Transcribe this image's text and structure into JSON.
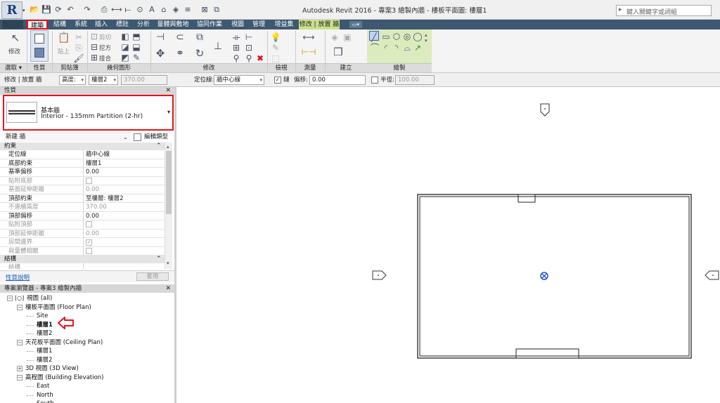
{
  "app": {
    "title": "Autodesk Revit 2016 -     專案3 繪製內牆 - 樓板平面圖: 樓層1",
    "search_placeholder": "鍵入關鍵字或詞組",
    "logo_letter": "R"
  },
  "qat_icons": [
    "open-icon",
    "save-icon",
    "sync-icon",
    "undo-icon",
    "redo-icon",
    "print-icon",
    "measure-icon",
    "dimension-icon",
    "tag-icon",
    "text-icon",
    "3d-view-icon",
    "section-icon",
    "thin-lines-icon",
    "close-views-icon",
    "switch-windows-icon"
  ],
  "tabs": [
    "建築",
    "結構",
    "系統",
    "插入",
    "標註",
    "分析",
    "量體與敷地",
    "協同作業",
    "視圖",
    "管理",
    "增益集",
    "修改 | 放置 牆"
  ],
  "ribbon": {
    "modify_label": "修改",
    "paste_label": "貼上",
    "cut_label": "剪切",
    "join_label": "接合",
    "cope_label": "挖方",
    "panels": [
      "選取 ▾",
      "性質",
      "剪貼簿",
      "幾何圖形",
      "修改",
      "檢視",
      "測量",
      "建立",
      "繪製"
    ]
  },
  "options_bar": {
    "context": "修改 | 放置 牆",
    "height_mode": "高度:",
    "level": "樓層2",
    "height_value": "370.00",
    "location_line_label": "定位線:",
    "location_line_value": "牆中心線",
    "chain_label": "鏈",
    "offset_label": "偏移:",
    "offset_value": "0.00",
    "radius_label": "半徑:",
    "radius_value": "100.00"
  },
  "properties": {
    "header": "性質",
    "family": "基本牆",
    "type": "Interior - 135mm Partition (2-hr)",
    "instance": "新建 牆",
    "edit_type": "編輯類型",
    "help": "性質說明",
    "apply": "套用",
    "categories": {
      "constraints": "約束",
      "structural": "結構"
    },
    "rows": [
      {
        "k": "定位線",
        "v": "牆中心線",
        "dim": false
      },
      {
        "k": "底部約束",
        "v": "樓層1",
        "dim": false
      },
      {
        "k": "基準偏移",
        "v": "0.00",
        "dim": false
      },
      {
        "k": "貼附底部",
        "v": "",
        "dim": true,
        "check": true
      },
      {
        "k": "基面延伸距離",
        "v": "0.00",
        "dim": true
      },
      {
        "k": "頂部約束",
        "v": "至樓層: 樓層2",
        "dim": false
      },
      {
        "k": "不連續高度",
        "v": "370.00",
        "dim": true
      },
      {
        "k": "頂部偏移",
        "v": "0.00",
        "dim": false
      },
      {
        "k": "貼附頂部",
        "v": "",
        "dim": true,
        "check": true
      },
      {
        "k": "頂部延伸距離",
        "v": "0.00",
        "dim": true
      },
      {
        "k": "房間邊界",
        "v": "✓",
        "dim": true,
        "check": true
      },
      {
        "k": "與量體相關",
        "v": "",
        "dim": true,
        "check": true
      }
    ],
    "struct_rows": [
      {
        "k": "結構",
        "v": "",
        "dim": true
      }
    ]
  },
  "browser": {
    "header": "專案瀏覽器 - 專案3 繪製內牆",
    "nodes": [
      {
        "t": "視圖 (all)",
        "lvl": 0,
        "exp": "-"
      },
      {
        "t": "樓板平面圖 (Floor Plan)",
        "lvl": 1,
        "exp": "-"
      },
      {
        "t": "Site",
        "lvl": 2,
        "exp": ""
      },
      {
        "t": "樓層1",
        "lvl": 2,
        "exp": "",
        "bold": true
      },
      {
        "t": "樓層2",
        "lvl": 2,
        "exp": ""
      },
      {
        "t": "天花板平面圖 (Ceiling Plan)",
        "lvl": 1,
        "exp": "-"
      },
      {
        "t": "樓層1",
        "lvl": 2,
        "exp": ""
      },
      {
        "t": "樓層2",
        "lvl": 2,
        "exp": ""
      },
      {
        "t": "3D 視圖 (3D View)",
        "lvl": 1,
        "exp": "+"
      },
      {
        "t": "高程圖 (Building Elevation)",
        "lvl": 1,
        "exp": "-"
      },
      {
        "t": "East",
        "lvl": 2,
        "exp": ""
      },
      {
        "t": "North",
        "lvl": 2,
        "exp": ""
      },
      {
        "t": "South",
        "lvl": 2,
        "exp": ""
      }
    ]
  },
  "colors": {
    "highlight": "#e0141b",
    "tabbar": "#3d5870",
    "context_tab": "#c9e08a",
    "draw_panel": "#dcebbd",
    "cursor_blue": "#1f55c8"
  }
}
